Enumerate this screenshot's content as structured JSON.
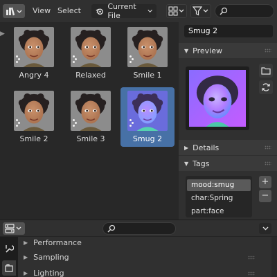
{
  "header": {
    "menu_view": "View",
    "menu_select": "Select",
    "library_dropdown": "Current File",
    "search_placeholder": ""
  },
  "assets": [
    {
      "label": "Angry 4",
      "selected": false,
      "tint": "normal"
    },
    {
      "label": "Relaxed",
      "selected": false,
      "tint": "normal"
    },
    {
      "label": "Smile 1",
      "selected": false,
      "tint": "normal"
    },
    {
      "label": "Smile 2",
      "selected": false,
      "tint": "normal"
    },
    {
      "label": "Smile 3",
      "selected": false,
      "tint": "normal"
    },
    {
      "label": "Smug 2",
      "selected": true,
      "tint": "normal-map"
    }
  ],
  "sidebar": {
    "asset_name": "Smug 2",
    "preview_label": "Preview",
    "details_label": "Details",
    "tags_label": "Tags",
    "tags": [
      "mood:smug",
      "char:Spring",
      "part:face"
    ],
    "active_tag_index": 0
  },
  "properties": {
    "search_placeholder": "",
    "panels": [
      {
        "label": "Performance",
        "expanded": false
      },
      {
        "label": "Sampling",
        "expanded": false
      },
      {
        "label": "Lighting",
        "expanded": false
      }
    ]
  },
  "colors": {
    "accent_selection": "#4771a6",
    "panel_bg": "#303030",
    "grid_bg": "#282828"
  }
}
